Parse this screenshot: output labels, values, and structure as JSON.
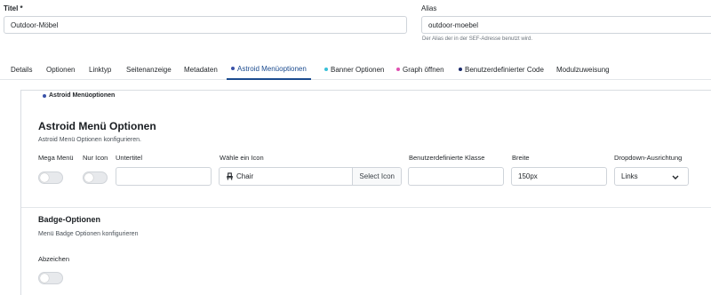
{
  "top": {
    "title_label": "Titel *",
    "title_value": "Outdoor-Möbel",
    "alias_label": "Alias",
    "alias_value": "outdoor-moebel",
    "alias_hint": "Der Alias der in der SEF-Adresse benutzt wird."
  },
  "tabs": [
    {
      "label": "Details"
    },
    {
      "label": "Optionen"
    },
    {
      "label": "Linktyp"
    },
    {
      "label": "Seitenanzeige"
    },
    {
      "label": "Metadaten"
    },
    {
      "label": "Astroid Menüoptionen",
      "dot": "#3a52a8",
      "active": true
    },
    {
      "label": "Banner Optionen",
      "dot": "#39c0d8"
    },
    {
      "label": "Graph öffnen",
      "dot": "#e04fb0"
    },
    {
      "label": "Benutzerdefinierter Code",
      "dot": "#1a2a6b"
    },
    {
      "label": "Modulzuweisung"
    }
  ],
  "fieldset": {
    "legend": "Astroid Menüoptionen",
    "legend_dot": "#3a52a8"
  },
  "astroid": {
    "heading": "Astroid Menü Optionen",
    "description": "Astroid Menü Optionen konfigurieren.",
    "mega_label": "Mega Menü",
    "nur_icon_label": "Nur Icon",
    "untertitel_label": "Untertitel",
    "untertitel_value": "",
    "icon_label": "Wähle ein Icon",
    "icon_value": "Chair",
    "select_icon_label": "Select Icon",
    "klasse_label": "Benutzerdefinierte Klasse",
    "klasse_value": "",
    "breite_label": "Breite",
    "breite_value": "150px",
    "dropdown_label": "Dropdown-Ausrichtung",
    "dropdown_value": "Links"
  },
  "badge": {
    "heading": "Badge-Optionen",
    "description": "Menü Badge Optionen konfigurieren",
    "abzeichen_label": "Abzeichen"
  },
  "colors": {
    "active_tab": "#1b4b8f"
  }
}
